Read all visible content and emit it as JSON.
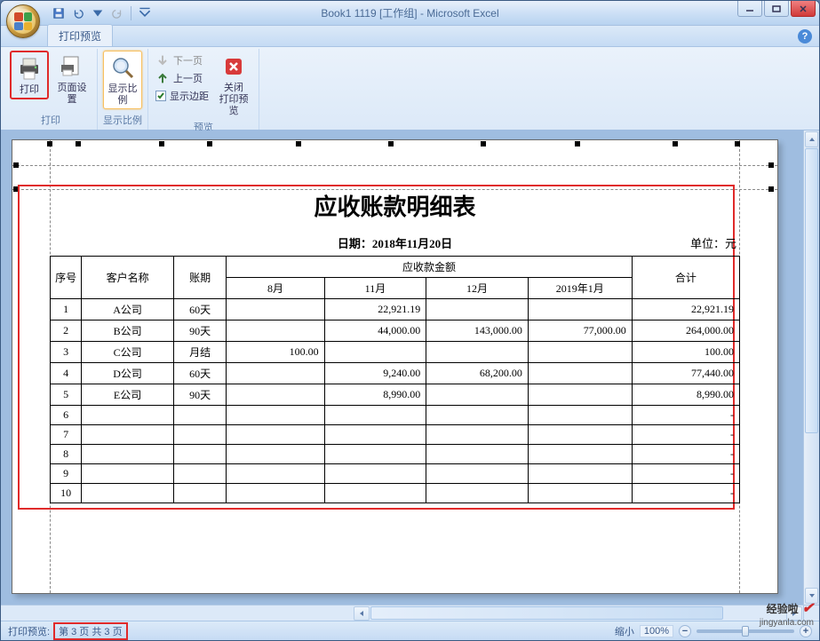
{
  "window": {
    "title": "Book1 1119  [工作组] - Microsoft Excel"
  },
  "qat": {
    "save": "保存",
    "undo": "撤销",
    "redo": "重做"
  },
  "tabs": {
    "print_preview": "打印预览"
  },
  "ribbon": {
    "print_group": {
      "label": "打印",
      "print_btn": "打印",
      "page_setup_btn": "页面设置"
    },
    "zoom_group": {
      "label": "显示比例",
      "zoom_btn": "显示比例"
    },
    "preview_group": {
      "label": "预览",
      "next_page": "下一页",
      "prev_page": "上一页",
      "show_margins": "显示边距",
      "close_btn": "关闭\n打印预览"
    }
  },
  "document": {
    "title": "应收账款明细表",
    "date_label": "日期：",
    "date_value": "2018年11月20日",
    "unit_label": "单位：元",
    "headers": {
      "seq": "序号",
      "customer": "客户名称",
      "period": "账期",
      "amount_group": "应收款金额",
      "m8": "8月",
      "m11": "11月",
      "m12": "12月",
      "m2019_1": "2019年1月",
      "total": "合计"
    },
    "rows": [
      {
        "seq": "1",
        "customer": "A公司",
        "period": "60天",
        "m8": "",
        "m11": "22,921.19",
        "m12": "",
        "m2019_1": "",
        "total": "22,921.19"
      },
      {
        "seq": "2",
        "customer": "B公司",
        "period": "90天",
        "m8": "",
        "m11": "44,000.00",
        "m12": "143,000.00",
        "m2019_1": "77,000.00",
        "total": "264,000.00"
      },
      {
        "seq": "3",
        "customer": "C公司",
        "period": "月结",
        "m8": "100.00",
        "m11": "",
        "m12": "",
        "m2019_1": "",
        "total": "100.00"
      },
      {
        "seq": "4",
        "customer": "D公司",
        "period": "60天",
        "m8": "",
        "m11": "9,240.00",
        "m12": "68,200.00",
        "m2019_1": "",
        "total": "77,440.00"
      },
      {
        "seq": "5",
        "customer": "E公司",
        "period": "90天",
        "m8": "",
        "m11": "8,990.00",
        "m12": "",
        "m2019_1": "",
        "total": "8,990.00"
      },
      {
        "seq": "6",
        "customer": "",
        "period": "",
        "m8": "",
        "m11": "",
        "m12": "",
        "m2019_1": "",
        "total": "-"
      },
      {
        "seq": "7",
        "customer": "",
        "period": "",
        "m8": "",
        "m11": "",
        "m12": "",
        "m2019_1": "",
        "total": "-"
      },
      {
        "seq": "8",
        "customer": "",
        "period": "",
        "m8": "",
        "m11": "",
        "m12": "",
        "m2019_1": "",
        "total": "-"
      },
      {
        "seq": "9",
        "customer": "",
        "period": "",
        "m8": "",
        "m11": "",
        "m12": "",
        "m2019_1": "",
        "total": "-"
      },
      {
        "seq": "10",
        "customer": "",
        "period": "",
        "m8": "",
        "m11": "",
        "m12": "",
        "m2019_1": "",
        "total": "-"
      }
    ]
  },
  "statusbar": {
    "mode_label": "打印预览",
    "page_info": "第 3 页 共 3 页",
    "zoom_label": "缩小",
    "zoom_value": "100%"
  },
  "watermark": {
    "brand": "经验啦",
    "url": "jingyanla.com"
  }
}
